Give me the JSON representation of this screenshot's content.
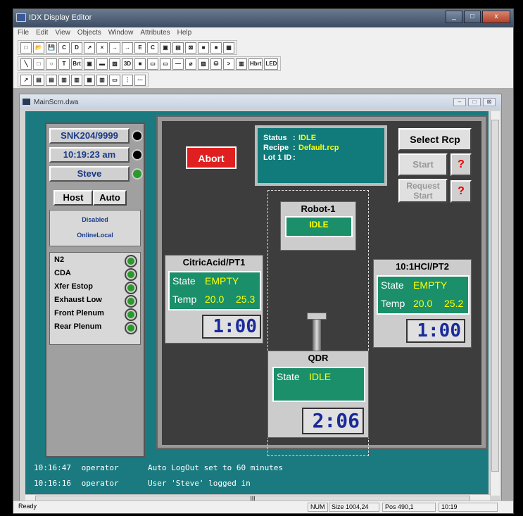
{
  "window": {
    "title": "IDX Display Editor",
    "minimize": "_",
    "maximize": "□",
    "close": "x"
  },
  "menu": [
    "File",
    "Edit",
    "View",
    "Objects",
    "Window",
    "Attributes",
    "Help"
  ],
  "toolbar1": [
    "□",
    "📂",
    "💾",
    "C",
    "D",
    "↗",
    "×",
    "→",
    "→",
    "E",
    "C",
    "▣",
    "▤",
    "⊠",
    "■",
    "■",
    "▦"
  ],
  "toolbar2": [
    "╲",
    "□",
    "○",
    "T",
    "Brt",
    "▣",
    "▬",
    "▨",
    "3D",
    "■",
    "▭",
    "▭",
    "—",
    "⌀",
    "▨",
    "⛁",
    ">",
    "▥",
    "Hbrt",
    "LED"
  ],
  "toolbar3": [
    "↗",
    "▤",
    "▤",
    "▥",
    "▥",
    "▦",
    "▥",
    "▭",
    "⋮",
    "⋯"
  ],
  "child": {
    "title": "MainScrn.dwa",
    "min": "–",
    "max": "□",
    "close": "⊠"
  },
  "left_panel": {
    "system_id": "SNK204/9999",
    "time": "10:19:23 am",
    "user": "Steve",
    "host_btn": "Host",
    "auto_btn": "Auto",
    "mode1": "Disabled",
    "mode2": "OnlineLocal",
    "signals": [
      "N2",
      "CDA",
      "Xfer Estop",
      "Exhaust Low",
      "Front Plenum",
      "Rear Plenum"
    ]
  },
  "main": {
    "abort": "Abort",
    "status": {
      "status_label": "Status",
      "status_value": "IDLE",
      "recipe_label": "Recipe",
      "recipe_value": "Default.rcp",
      "lot_label": "Lot 1 ID",
      "sep": ":"
    },
    "select_rcp": "Select Rcp",
    "start": "Start",
    "request_start_1": "Request",
    "request_start_2": "Start",
    "qmark": "?",
    "robot": {
      "title": "Robot-1",
      "state": "IDLE"
    },
    "pt1": {
      "title": "CitricAcid/PT1",
      "state_label": "State",
      "state_value": "EMPTY",
      "temp_label": "Temp",
      "temp1": "20.0",
      "temp2": "25.3",
      "timer": "1:00"
    },
    "pt2": {
      "title": "10:1HCl/PT2",
      "state_label": "State",
      "state_value": "EMPTY",
      "temp_label": "Temp",
      "temp1": "20.0",
      "temp2": "25.2",
      "timer": "1:00"
    },
    "qdr": {
      "title": "QDR",
      "state_label": "State",
      "state_value": "IDLE",
      "timer": "2:06"
    }
  },
  "log": [
    {
      "time": "10:16:47",
      "user": "operator",
      "msg": "Auto LogOut set to 60 minutes"
    },
    {
      "time": "10:16:16",
      "user": "operator",
      "msg": "User 'Steve' logged in"
    }
  ],
  "hscroll_grip": "III",
  "statusbar": {
    "ready": "Ready",
    "num": "NUM",
    "size": "Size 1004,24",
    "pos": "Pos 490,1",
    "time": "10:19"
  }
}
